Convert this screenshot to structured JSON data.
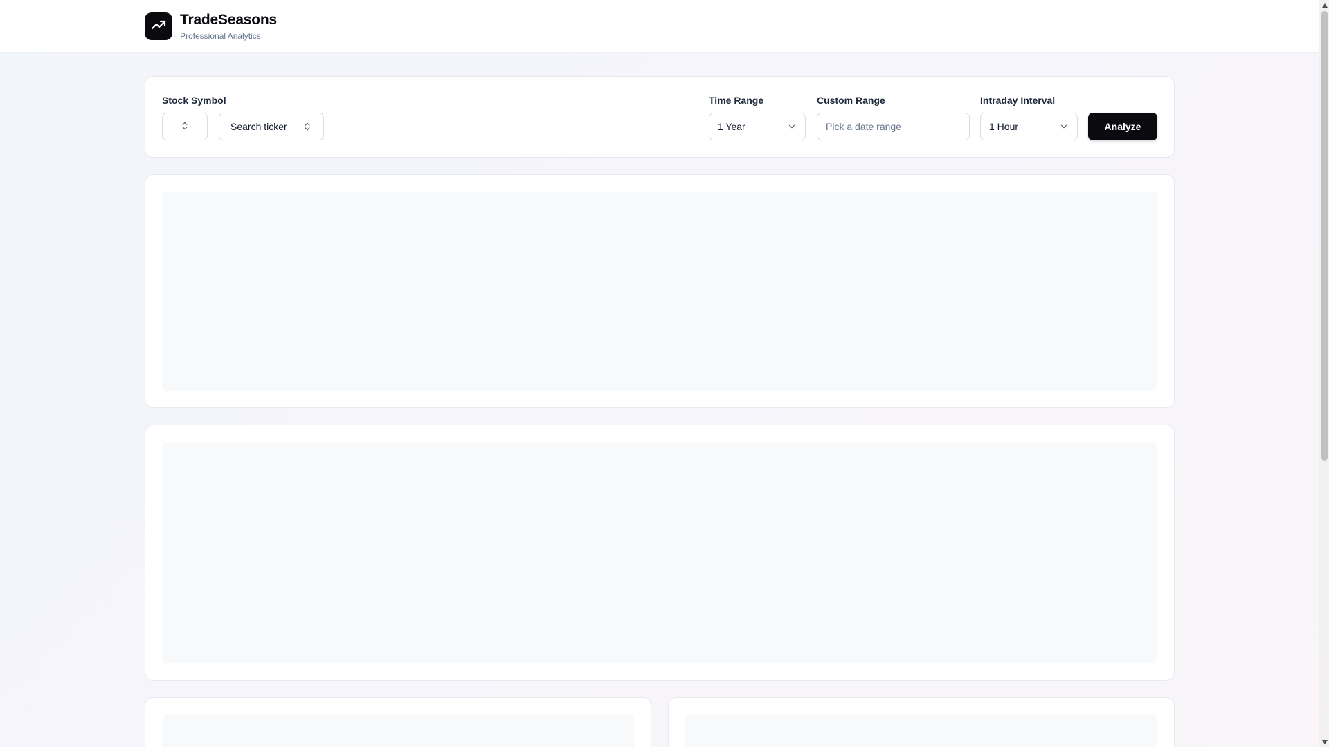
{
  "app": {
    "title": "TradeSeasons",
    "subtitle": "Professional Analytics",
    "logo_icon": "trending-up-icon"
  },
  "controls": {
    "stock_symbol_label": "Stock Symbol",
    "exchange_value": "",
    "ticker_placeholder": "Search ticker",
    "time_range_label": "Time Range",
    "time_range_value": "1 Year",
    "custom_range_label": "Custom Range",
    "custom_range_placeholder": "Pick a date range",
    "intraday_label": "Intraday Interval",
    "intraday_value": "1 Hour",
    "analyze_label": "Analyze"
  },
  "colors": {
    "primary": "#0b0b0f",
    "border": "#d8dce3",
    "muted_text": "#64748b",
    "skeleton": "#f8f9fb"
  }
}
